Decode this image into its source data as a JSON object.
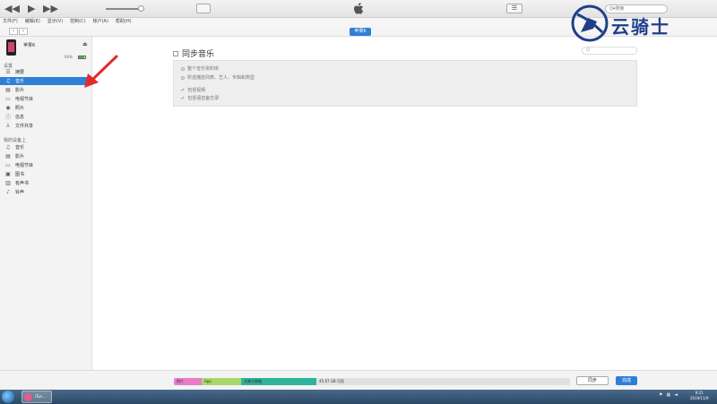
{
  "menubar": [
    "文件(F)",
    "编辑(E)",
    "显示(V)",
    "控制(C)",
    "帐户(A)",
    "帮助(H)"
  ],
  "search_top": {
    "placeholder": "Q▾搜索"
  },
  "device_badge": "苹果6",
  "device": {
    "name": "苹果6",
    "capacity": "64%"
  },
  "sidebar": {
    "settings_header": "设置",
    "settings_items": [
      {
        "icon": "summary-icon",
        "glyph": "☰",
        "label": "摘要"
      },
      {
        "icon": "music-note-icon",
        "glyph": "♫",
        "label": "音乐"
      },
      {
        "icon": "movie-icon",
        "glyph": "▤",
        "label": "影片"
      },
      {
        "icon": "tv-icon",
        "glyph": "▭",
        "label": "电视节目"
      },
      {
        "icon": "camera-icon",
        "glyph": "◉",
        "label": "照片"
      },
      {
        "icon": "info-icon",
        "glyph": "ⓘ",
        "label": "信息"
      },
      {
        "icon": "file-share-icon",
        "glyph": "⅄",
        "label": "文件共享"
      }
    ],
    "device_header": "我的设备上",
    "device_items": [
      {
        "icon": "music-note-icon",
        "glyph": "♫",
        "label": "音乐"
      },
      {
        "icon": "movie-icon",
        "glyph": "▤",
        "label": "影片"
      },
      {
        "icon": "tv-icon",
        "glyph": "▭",
        "label": "电视节目"
      },
      {
        "icon": "book-icon",
        "glyph": "▣",
        "label": "图书"
      },
      {
        "icon": "audiobook-icon",
        "glyph": "▥",
        "label": "有声书"
      },
      {
        "icon": "bell-icon",
        "glyph": "♪",
        "label": "铃声"
      }
    ]
  },
  "main": {
    "sync_title": "同步音乐",
    "search_placeholder": "Q",
    "options": [
      {
        "type": "radio",
        "label": "整个音乐资料库"
      },
      {
        "type": "radio",
        "label": "所选播放列表、艺人、专辑和类型"
      },
      {
        "type": "check",
        "label": "包括视频"
      },
      {
        "type": "check",
        "label": "包括语音备忘录"
      }
    ]
  },
  "storage": [
    {
      "label": "照片",
      "color": "#e87cc8",
      "fraction": 0.07
    },
    {
      "label": "App",
      "color": "#a8d86c",
      "fraction": 0.1
    },
    {
      "label": "文稿与数据",
      "color": "#2fb39a",
      "fraction": 0.19
    },
    {
      "label": "45.67 GB 可用",
      "color": "#e0e0e0",
      "fraction": 0.64
    }
  ],
  "buttons": {
    "revert": "同步",
    "done": "完成"
  },
  "taskbar": {
    "app_label": "iTun...",
    "time": "9:21",
    "date": "2019/11/9"
  },
  "watermark": {
    "text": "云骑士"
  },
  "colors": {
    "accent": "#2f7fd6",
    "annotation": "#e02b2b"
  }
}
